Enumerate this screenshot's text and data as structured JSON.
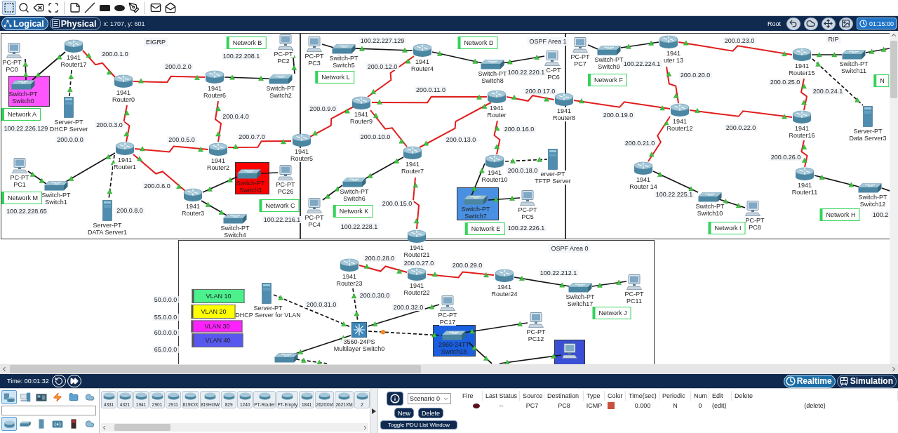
{
  "toolbar": {
    "tools": [
      {
        "kind": "select",
        "selected": true
      },
      {
        "kind": "inspect",
        "selected": false
      },
      {
        "kind": "delete",
        "selected": false
      },
      {
        "kind": "resize",
        "selected": false
      },
      {
        "kind": "note",
        "selected": false
      },
      {
        "kind": "line",
        "selected": false
      },
      {
        "kind": "rectangle",
        "selected": false
      },
      {
        "kind": "ellipse",
        "selected": false
      },
      {
        "kind": "freeform",
        "selected": false
      },
      {
        "kind": "simple-pdu",
        "selected": false
      },
      {
        "kind": "complex-pdu",
        "selected": false
      }
    ]
  },
  "view_bar": {
    "tabs": [
      {
        "label": "Logical",
        "kind": "logical",
        "selected": true
      },
      {
        "label": "Physical",
        "kind": "physical",
        "selected": false
      }
    ],
    "coordinates": "x: 1707, y: 601",
    "path": "Root",
    "tools": [
      {
        "kind": "back"
      },
      {
        "kind": "cluster"
      },
      {
        "kind": "move"
      },
      {
        "kind": "background"
      }
    ],
    "clock": "01:15:00"
  },
  "canvas": {
    "areas": [
      {
        "label": "EIGRP"
      },
      {
        "label": "OSPF Area 1"
      },
      {
        "label": "RIP"
      },
      {
        "label": "OSPF Area 0"
      }
    ],
    "shapes": [
      {
        "color": "#ff55ff"
      },
      {
        "color": "#ff0000"
      },
      {
        "color": "#4a90e2"
      },
      {
        "color": "#1a5fe0"
      },
      {
        "color": "#3b4fd6"
      }
    ],
    "links": [
      {
        "kind": "straight",
        "learning": false
      },
      {
        "kind": "straight",
        "learning": false
      },
      {
        "kind": "crossover",
        "learning": false
      },
      {
        "kind": "serial",
        "learning": false
      },
      {
        "kind": "serial",
        "learning": false
      },
      {
        "kind": "straight",
        "learning": false
      },
      {
        "kind": "straight",
        "learning": false
      },
      {
        "kind": "serial",
        "learning": false
      },
      {
        "kind": "serial",
        "learning": false
      },
      {
        "kind": "serial",
        "learning": false
      },
      {
        "kind": "serial",
        "learning": false
      },
      {
        "kind": "straight",
        "learning": false
      },
      {
        "kind": "straight",
        "learning": false
      },
      {
        "kind": "crossover",
        "learning": false
      },
      {
        "kind": "serial",
        "learning": false
      },
      {
        "kind": "straight",
        "learning": false
      },
      {
        "kind": "straight",
        "learning": false
      },
      {
        "kind": "straight",
        "learning": false
      },
      {
        "kind": "straight",
        "learning": false
      },
      {
        "kind": "straight",
        "learning": false
      },
      {
        "kind": "straight",
        "learning": false
      },
      {
        "kind": "straight",
        "learning": false
      },
      {
        "kind": "serial",
        "learning": false
      },
      {
        "kind": "serial",
        "learning": false
      },
      {
        "kind": "serial",
        "learning": false
      },
      {
        "kind": "serial",
        "learning": false
      },
      {
        "kind": "serial",
        "learning": false
      },
      {
        "kind": "serial",
        "learning": false
      },
      {
        "kind": "serial",
        "learning": false
      },
      {
        "kind": "crossover",
        "learning": false
      },
      {
        "kind": "straight",
        "learning": false
      },
      {
        "kind": "straight",
        "learning": false
      },
      {
        "kind": "serial",
        "learning": false
      },
      {
        "kind": "straight",
        "learning": false
      },
      {
        "kind": "straight",
        "learning": false
      },
      {
        "kind": "straight",
        "learning": false
      },
      {
        "kind": "straight",
        "learning": false
      },
      {
        "kind": "serial",
        "learning": false
      },
      {
        "kind": "straight",
        "learning": false
      },
      {
        "kind": "straight",
        "learning": false
      },
      {
        "kind": "crossover",
        "learning": false
      },
      {
        "kind": "serial",
        "learning": false
      },
      {
        "kind": "serial",
        "learning": false
      },
      {
        "kind": "serial",
        "learning": false
      },
      {
        "kind": "serial",
        "learning": false
      },
      {
        "kind": "serial",
        "learning": false
      },
      {
        "kind": "straight",
        "learning": false
      },
      {
        "kind": "straight",
        "learning": false
      },
      {
        "kind": "serial",
        "learning": false
      },
      {
        "kind": "straight",
        "learning": false
      },
      {
        "kind": "straight",
        "learning": false
      },
      {
        "kind": "serial",
        "learning": false
      },
      {
        "kind": "serial",
        "learning": false
      },
      {
        "kind": "straight",
        "learning": false
      },
      {
        "kind": "straight",
        "learning": false
      },
      {
        "kind": "crossover",
        "learning": false
      },
      {
        "kind": "crossover",
        "learning": false
      },
      {
        "kind": "straight",
        "learning": false
      },
      {
        "kind": "crossover",
        "learning": true
      },
      {
        "kind": "straight",
        "learning": false
      },
      {
        "kind": "crossover",
        "learning": false
      },
      {
        "kind": "straight",
        "learning": false
      },
      {
        "kind": "straight",
        "learning": false
      },
      {
        "kind": "straight",
        "learning": false
      }
    ],
    "devices": [
      {
        "kind": "pc",
        "model": "PC-PT",
        "name": "PC0"
      },
      {
        "kind": "router",
        "model": "1941",
        "name": "Router17"
      },
      {
        "kind": "switch",
        "model": "Switch-PT",
        "name": "Switch0"
      },
      {
        "kind": "server",
        "model": "Server-PT",
        "name": "DHCP Server"
      },
      {
        "kind": "router",
        "model": "1941",
        "name": "Router0"
      },
      {
        "kind": "router",
        "model": "1941",
        "name": "Router6"
      },
      {
        "kind": "pc",
        "model": "PC-PT",
        "name": "PC2"
      },
      {
        "kind": "switch",
        "model": "Switch-PT",
        "name": "Switch2"
      },
      {
        "kind": "router",
        "model": "1941",
        "name": "Router1"
      },
      {
        "kind": "router",
        "model": "1941",
        "name": "Router2"
      },
      {
        "kind": "router",
        "model": "1941",
        "name": "Router5"
      },
      {
        "kind": "pc",
        "model": "PC-PT",
        "name": "PC1"
      },
      {
        "kind": "switch",
        "model": "Switch-PT",
        "name": "Switch1"
      },
      {
        "kind": "server",
        "model": "Server-PT",
        "name": "DATA Server1"
      },
      {
        "kind": "router",
        "model": "1941",
        "name": "Router3"
      },
      {
        "kind": "switch",
        "model": "Switch-PT",
        "name": "Switch3"
      },
      {
        "kind": "pc",
        "model": "PC-PT",
        "name": "PC26"
      },
      {
        "kind": "switch",
        "model": "Switch-PT",
        "name": "Switch4"
      },
      {
        "kind": "pc",
        "model": "PC-PT",
        "name": "PC3"
      },
      {
        "kind": "switch",
        "model": "Switch-PT",
        "name": "Switch5"
      },
      {
        "kind": "router",
        "model": "1941",
        "name": "Router4"
      },
      {
        "kind": "switch",
        "model": "Switch-PT",
        "name": "Switch8"
      },
      {
        "kind": "pc",
        "model": "C-PT",
        "name": "PC6"
      },
      {
        "kind": "router",
        "model": "1941",
        "name": "Router9"
      },
      {
        "kind": "router",
        "model": "1941",
        "name": "Router"
      },
      {
        "kind": "router",
        "model": "1941",
        "name": "Router8"
      },
      {
        "kind": "router",
        "model": "1941",
        "name": "Router7"
      },
      {
        "kind": "router",
        "model": "1941",
        "name": "Router10"
      },
      {
        "kind": "server",
        "model": "erver-PT",
        "name": "TFTP Server"
      },
      {
        "kind": "switch",
        "model": "Switch-PT",
        "name": "Switch6"
      },
      {
        "kind": "pc",
        "model": "PC-PT",
        "name": "PC4"
      },
      {
        "kind": "switch",
        "model": "Switch-PT",
        "name": "Switch7"
      },
      {
        "kind": "pc",
        "model": "PC-PT",
        "name": "PC5"
      },
      {
        "kind": "router",
        "model": "1941",
        "name": "Router21"
      },
      {
        "kind": "pc",
        "model": "PC-PT",
        "name": "PC7"
      },
      {
        "kind": "switch",
        "model": "Switch-PT",
        "name": "Switch9"
      },
      {
        "kind": "router",
        "model": "1941",
        "name": "uter 13"
      },
      {
        "kind": "router",
        "model": "1941",
        "name": "Router15"
      },
      {
        "kind": "switch",
        "model": "Switch-PT",
        "name": "Switch11"
      },
      {
        "kind": "server",
        "model": "Server-PT",
        "name": "Data Server3"
      },
      {
        "kind": "router",
        "model": "1941",
        "name": "Router12"
      },
      {
        "kind": "router",
        "model": "1941",
        "name": "Router16"
      },
      {
        "kind": "router",
        "model": "1941",
        "name": "Router 14"
      },
      {
        "kind": "router",
        "model": "1941",
        "name": "Router11"
      },
      {
        "kind": "switch",
        "model": "Switch-PT",
        "name": "Switch10"
      },
      {
        "kind": "pc",
        "model": "PC-PT",
        "name": "PC8"
      },
      {
        "kind": "switch",
        "model": "Switch-PT",
        "name": "Switch12"
      },
      {
        "kind": "router",
        "model": "1941",
        "name": "Router23"
      },
      {
        "kind": "router",
        "model": "1941",
        "name": "Router22"
      },
      {
        "kind": "router",
        "model": "1941",
        "name": "Router24"
      },
      {
        "kind": "switch",
        "model": "Switch-PT",
        "name": "Switch17"
      },
      {
        "kind": "pc",
        "model": "PC-PT",
        "name": "PC11"
      },
      {
        "kind": "server",
        "model": "Server-PT",
        "name": "DHCP Server for VLAN"
      },
      {
        "kind": "pc",
        "model": "PC-PT",
        "name": "PC17"
      },
      {
        "kind": "multilayer",
        "model": "3560-24PS",
        "name": "Multilayer Switch0"
      },
      {
        "kind": "switch",
        "model": "2960-24TT",
        "name": "Switch18"
      },
      {
        "kind": "pc",
        "model": "PC-PT",
        "name": "PC12"
      },
      {
        "kind": "switch"
      },
      {
        "kind": "pc"
      }
    ],
    "notes": [
      {
        "kind": "network",
        "text": "Network B"
      },
      {
        "kind": "address",
        "text": "100.22.208.1"
      },
      {
        "kind": "address",
        "text": "200.0.1.0"
      },
      {
        "kind": "address",
        "text": "200.0.2.0"
      },
      {
        "kind": "network",
        "text": "Network A"
      },
      {
        "kind": "address",
        "text": "100.22.226.129"
      },
      {
        "kind": "address",
        "text": "200.0.0.0"
      },
      {
        "kind": "address",
        "text": "200.0.3.0"
      },
      {
        "kind": "address",
        "text": "200.0.4.0"
      },
      {
        "kind": "address",
        "text": "200.0.5.0"
      },
      {
        "kind": "address",
        "text": "200.0.7.0"
      },
      {
        "kind": "network",
        "text": "Network M"
      },
      {
        "kind": "address",
        "text": "100.22.228.65"
      },
      {
        "kind": "address",
        "text": "200.0.6.0"
      },
      {
        "kind": "address",
        "text": "200.0.8.0"
      },
      {
        "kind": "network",
        "text": "Network C"
      },
      {
        "kind": "address",
        "text": "100.22.216.1"
      },
      {
        "kind": "address",
        "text": "100.22.227.129"
      },
      {
        "kind": "network",
        "text": "Network D"
      },
      {
        "kind": "network",
        "text": "Network L"
      },
      {
        "kind": "address",
        "text": "200.0.12.0"
      },
      {
        "kind": "address",
        "text": "100.22.220.1"
      },
      {
        "kind": "address",
        "text": "200.0.11.0"
      },
      {
        "kind": "address",
        "text": "200.0.17.0"
      },
      {
        "kind": "address",
        "text": "200.0.9.0"
      },
      {
        "kind": "address",
        "text": "200.0.10.0"
      },
      {
        "kind": "address",
        "text": "200.0.13.0"
      },
      {
        "kind": "address",
        "text": "200.0.16.0"
      },
      {
        "kind": "address",
        "text": "200.0.18.0"
      },
      {
        "kind": "network",
        "text": "Network K"
      },
      {
        "kind": "address",
        "text": "100.22.228.1"
      },
      {
        "kind": "address",
        "text": "200.0.15.0"
      },
      {
        "kind": "network",
        "text": "Network E"
      },
      {
        "kind": "address",
        "text": "100.22.226.1"
      },
      {
        "kind": "address",
        "text": "200.0.23.0"
      },
      {
        "kind": "address",
        "text": "100.22.224.1"
      },
      {
        "kind": "network",
        "text": "Network F"
      },
      {
        "kind": "address",
        "text": "200.0.20.0"
      },
      {
        "kind": "address",
        "text": "200.0.25.0"
      },
      {
        "kind": "address",
        "text": "200.0.24.1"
      },
      {
        "kind": "network",
        "text": "N"
      },
      {
        "kind": "address",
        "text": "200.0.19.0"
      },
      {
        "kind": "address",
        "text": "200.0.22.0"
      },
      {
        "kind": "address",
        "text": "200.0.21.0"
      },
      {
        "kind": "address",
        "text": "200.0.26.0"
      },
      {
        "kind": "address",
        "text": "100.22.225.1"
      },
      {
        "kind": "network",
        "text": "Network I"
      },
      {
        "kind": "network",
        "text": "Network H"
      },
      {
        "kind": "address",
        "text": "100.2"
      },
      {
        "kind": "address",
        "text": "200.0.28.0"
      },
      {
        "kind": "address",
        "text": "200.0.27.0"
      },
      {
        "kind": "address",
        "text": "200.0.29.0"
      },
      {
        "kind": "address",
        "text": "100.22.212.1"
      },
      {
        "kind": "network",
        "text": "Network J"
      },
      {
        "kind": "address",
        "text": "200.0.30.0"
      },
      {
        "kind": "address",
        "text": "200.0.31.0"
      },
      {
        "kind": "address",
        "text": "200.0.32.0"
      },
      {
        "kind": "vlan",
        "text": "VLAN 10",
        "color": "#4cf08c"
      },
      {
        "kind": "vlan",
        "text": "VLAN 20",
        "color": "#ffff00"
      },
      {
        "kind": "vlan",
        "text": "VLAN 30",
        "color": "#ff22ff"
      },
      {
        "kind": "vlan",
        "text": "VLAN 40",
        "color": "#5858ee"
      },
      {
        "kind": "address",
        "text": "50.0.0.0"
      },
      {
        "kind": "address",
        "text": "55.0.0.0"
      },
      {
        "kind": "address",
        "text": "60.0.0.0"
      },
      {
        "kind": "address",
        "text": "65.0.0.0"
      }
    ]
  },
  "sim_bar": {
    "time": "Time: 00:01:32",
    "controls": [
      {
        "kind": "reset"
      },
      {
        "kind": "fast-forward"
      }
    ],
    "modes": [
      {
        "label": "Realtime",
        "kind": "realtime",
        "selected": true
      },
      {
        "label": "Simulation",
        "kind": "simulation",
        "selected": false
      }
    ]
  },
  "device_panel": {
    "categories": [
      {
        "kind": "network-devices",
        "selected": true
      },
      {
        "kind": "end-devices",
        "selected": false
      },
      {
        "kind": "components",
        "selected": false
      },
      {
        "kind": "connections",
        "selected": false
      },
      {
        "kind": "miscellaneous",
        "selected": false
      },
      {
        "kind": "multiuser",
        "selected": false
      }
    ],
    "subcategories": [
      {
        "kind": "routers",
        "selected": true
      },
      {
        "kind": "switches",
        "selected": false
      },
      {
        "kind": "hubs",
        "selected": false
      },
      {
        "kind": "wireless",
        "selected": false
      },
      {
        "kind": "security",
        "selected": false
      },
      {
        "kind": "wan-emulation",
        "selected": false
      }
    ],
    "models": [
      "4331",
      "4321",
      "1941",
      "2901",
      "2911",
      "819IOX",
      "819HGW",
      "829",
      "1240",
      "PT-Router",
      "PT-Empty",
      "1841",
      "2620XM",
      "2621XM",
      "2"
    ]
  },
  "scenario_panel": {
    "scenario": "Scenario 0",
    "buttons": [
      "New",
      "Delete"
    ],
    "toggle": "Toggle PDU List Window"
  },
  "pdu_table": {
    "columns": [
      "Fire",
      "Last Status",
      "Source",
      "Destination",
      "Type",
      "Color",
      "Time(sec)",
      "Periodic",
      "Num",
      "Edit",
      "Delete"
    ],
    "rows": [
      {
        "last_status": "--",
        "source": "PC7",
        "destination": "PC8",
        "type": "ICMP",
        "color": "#c8503c",
        "time": "0.000",
        "periodic": "N",
        "num": "0",
        "edit": "(edit)",
        "delete": "(delete)"
      }
    ]
  }
}
